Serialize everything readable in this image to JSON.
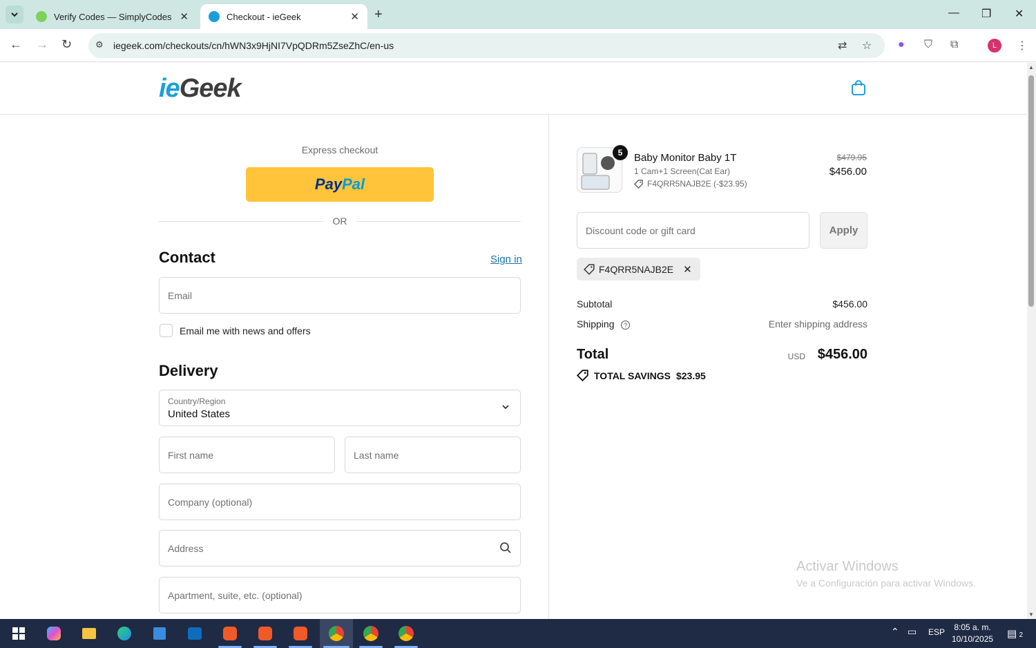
{
  "browser": {
    "tabs": [
      {
        "title": "Verify Codes — SimplyCodes",
        "active": false
      },
      {
        "title": "Checkout - ieGeek",
        "active": true
      }
    ],
    "url": "iegeek.com/checkouts/cn/hWN3x9HjNI7VpQDRm5ZseZhC/en-us",
    "profile_initial": "L"
  },
  "header": {
    "logo_part1": "ie",
    "logo_part2": "Geek"
  },
  "checkout": {
    "express_label": "Express checkout",
    "paypal_part1": "Pay",
    "paypal_part2": "Pal",
    "or_label": "OR",
    "contact_title": "Contact",
    "signin_label": "Sign in",
    "email_placeholder": "Email",
    "newsletter_label": "Email me with news and offers",
    "delivery_title": "Delivery",
    "country_label": "Country/Region",
    "country_value": "United States",
    "first_name_placeholder": "First name",
    "last_name_placeholder": "Last name",
    "company_placeholder": "Company (optional)",
    "address_placeholder": "Address",
    "apartment_placeholder": "Apartment, suite, etc. (optional)"
  },
  "summary": {
    "product": {
      "name": "Baby Monitor Baby 1T",
      "variant": "1 Cam+1 Screen(Cat Ear)",
      "discount": "F4QRR5NAJB2E (-$23.95)",
      "quantity": "5",
      "price_original": "$479.95",
      "price_final": "$456.00"
    },
    "discount_placeholder": "Discount code or gift card",
    "apply_label": "Apply",
    "applied_code": "F4QRR5NAJB2E",
    "subtotal_label": "Subtotal",
    "subtotal_value": "$456.00",
    "shipping_label": "Shipping",
    "shipping_value": "Enter shipping address",
    "total_label": "Total",
    "total_currency": "USD",
    "total_value": "$456.00",
    "savings_label": "TOTAL SAVINGS",
    "savings_value": "$23.95"
  },
  "watermark": {
    "line1": "Activar Windows",
    "line2": "Ve a Configuración para activar Windows."
  },
  "taskbar": {
    "language": "ESP",
    "time": "8:05 a. m.",
    "date": "10/10/2025",
    "notification_count": "2"
  },
  "colors": {
    "accent": "#1773b0",
    "paypal_yellow": "#ffc439",
    "brand_blue": "#1aa0d8"
  }
}
